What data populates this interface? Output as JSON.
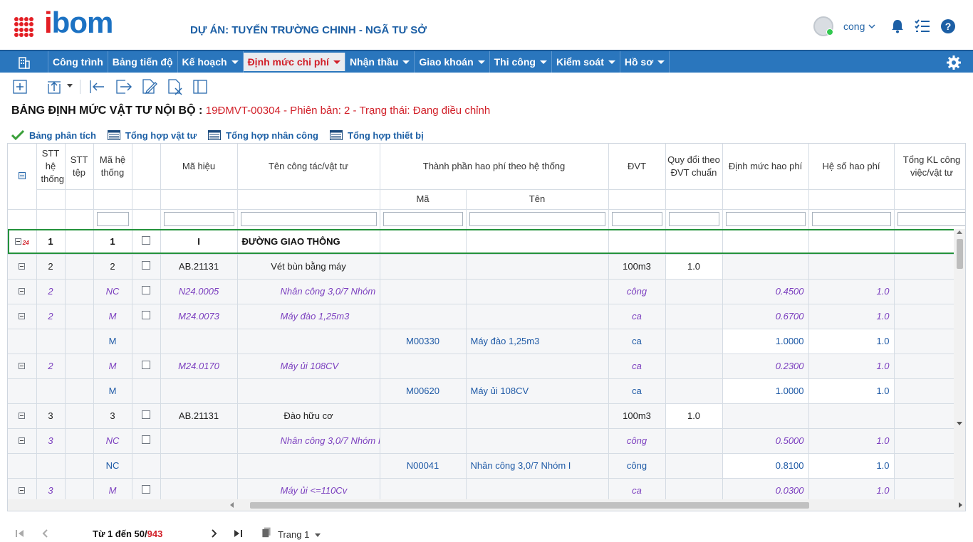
{
  "header": {
    "logo": {
      "part1": "i",
      "part2": "bom"
    },
    "project_title": "DỰ ÁN: TUYẾN TRƯỜNG CHINH - NGÃ TƯ SỞ",
    "username": "cong"
  },
  "nav": {
    "items": [
      {
        "label": "Công trình",
        "dropdown": false
      },
      {
        "label": "Bảng tiến độ",
        "dropdown": false
      },
      {
        "label": "Kế hoạch",
        "dropdown": true
      },
      {
        "label": "Định mức chi phí",
        "dropdown": true,
        "active": true
      },
      {
        "label": "Nhận thầu",
        "dropdown": true
      },
      {
        "label": "Giao khoán",
        "dropdown": true
      },
      {
        "label": "Thi công",
        "dropdown": true
      },
      {
        "label": "Kiểm soát",
        "dropdown": true
      },
      {
        "label": "Hồ sơ",
        "dropdown": true
      }
    ]
  },
  "doc": {
    "title": "BẢNG ĐỊNH MỨC VẬT TƯ NỘI BỘ :",
    "subtitle": "19ĐMVT-00304 - Phiên bản: 2 - Trạng thái: Đang điều chỉnh"
  },
  "tabs": [
    {
      "label": "Bảng phân tích",
      "icon": "check-icon"
    },
    {
      "label": "Tổng hợp vật tư",
      "icon": "table-icon"
    },
    {
      "label": "Tổng hợp nhân công",
      "icon": "table-icon"
    },
    {
      "label": "Tổng hợp thiết bị",
      "icon": "table-icon"
    }
  ],
  "grid": {
    "headers": {
      "stt_he_thong": "STT hệ thống",
      "stt_tep": "STT tệp",
      "ma_he_thong": "Mã hệ thống",
      "ma_hieu": "Mã hiệu",
      "ten_cong_tac": "Tên công tác/vật tư",
      "thanh_phan": "Thành phần hao phí theo hệ thống",
      "ma": "Mã",
      "ten": "Tên",
      "dvt": "ĐVT",
      "quy_doi": "Quy đổi theo ĐVT chuẩn",
      "dinh_muc": "Định mức hao phí",
      "he_so": "Hệ số hao phí",
      "tong_kl": "Tổng KL công việc/vật tư"
    },
    "rows": [
      {
        "type": "group",
        "expander": true,
        "count": "24",
        "stt": "1",
        "stt_tep": "",
        "ma_ht": "1",
        "checkbox": true,
        "ma_hieu": "I",
        "ten": "ĐƯỜNG GIAO THÔNG",
        "tp_ma": "",
        "tp_ten": "",
        "dvt": "",
        "quy_doi": "",
        "dinh_muc": "",
        "he_so": ""
      },
      {
        "type": "plain",
        "expander": true,
        "stt": "2",
        "stt_tep": "",
        "ma_ht": "2",
        "checkbox": true,
        "ma_hieu": "AB.21131",
        "ten": "Vét bùn bằng máy",
        "tp_ma": "",
        "tp_ten": "",
        "dvt": "100m3",
        "quy_doi": "1.0",
        "dinh_muc": "",
        "he_so": ""
      },
      {
        "type": "ital",
        "expander": true,
        "stt": "2",
        "stt_tep": "",
        "ma_ht": "NC",
        "checkbox": true,
        "ma_hieu": "N24.0005",
        "ten": "Nhân công 3,0/7 Nhóm",
        "tp_ma": "",
        "tp_ten": "",
        "dvt": "công",
        "quy_doi": "",
        "dinh_muc": "0.4500",
        "he_so": "1.0"
      },
      {
        "type": "ital",
        "expander": true,
        "stt": "2",
        "stt_tep": "",
        "ma_ht": "M",
        "checkbox": true,
        "ma_hieu": "M24.0073",
        "ten": "Máy đào 1,25m3",
        "tp_ma": "",
        "tp_ten": "",
        "dvt": "ca",
        "quy_doi": "",
        "dinh_muc": "0.6700",
        "he_so": "1.0"
      },
      {
        "type": "det",
        "expander": false,
        "stt": "",
        "stt_tep": "",
        "ma_ht": "M",
        "checkbox": false,
        "ma_hieu": "",
        "ten": "",
        "tp_ma": "M00330",
        "tp_ten": "Máy đào 1,25m3",
        "dvt": "ca",
        "quy_doi": "",
        "dinh_muc": "1.0000",
        "he_so": "1.0"
      },
      {
        "type": "ital",
        "expander": true,
        "stt": "2",
        "stt_tep": "",
        "ma_ht": "M",
        "checkbox": true,
        "ma_hieu": "M24.0170",
        "ten": "Máy ủi 108CV",
        "tp_ma": "",
        "tp_ten": "",
        "dvt": "ca",
        "quy_doi": "",
        "dinh_muc": "0.2300",
        "he_so": "1.0"
      },
      {
        "type": "det",
        "expander": false,
        "stt": "",
        "stt_tep": "",
        "ma_ht": "M",
        "checkbox": false,
        "ma_hieu": "",
        "ten": "",
        "tp_ma": "M00620",
        "tp_ten": "Máy ủi 108CV",
        "dvt": "ca",
        "quy_doi": "",
        "dinh_muc": "1.0000",
        "he_so": "1.0"
      },
      {
        "type": "plain",
        "expander": true,
        "stt": "3",
        "stt_tep": "",
        "ma_ht": "3",
        "checkbox": true,
        "ma_hieu": "AB.21131",
        "ten": "Đào hữu cơ",
        "tp_ma": "",
        "tp_ten": "",
        "dvt": "100m3",
        "quy_doi": "1.0",
        "dinh_muc": "",
        "he_so": ""
      },
      {
        "type": "ital",
        "expander": true,
        "stt": "3",
        "stt_tep": "",
        "ma_ht": "NC",
        "checkbox": true,
        "ma_hieu": "",
        "ten": "Nhân công 3,0/7 Nhóm I",
        "tp_ma": "",
        "tp_ten": "",
        "dvt": "công",
        "quy_doi": "",
        "dinh_muc": "0.5000",
        "he_so": "1.0"
      },
      {
        "type": "det",
        "expander": false,
        "stt": "",
        "stt_tep": "",
        "ma_ht": "NC",
        "checkbox": false,
        "ma_hieu": "",
        "ten": "",
        "tp_ma": "N00041",
        "tp_ten": "Nhân công 3,0/7 Nhóm I",
        "dvt": "công",
        "quy_doi": "",
        "dinh_muc": "0.8100",
        "he_so": "1.0"
      },
      {
        "type": "ital",
        "expander": true,
        "stt": "3",
        "stt_tep": "",
        "ma_ht": "M",
        "checkbox": true,
        "ma_hieu": "",
        "ten": "Máy ủi <=110Cv",
        "tp_ma": "",
        "tp_ten": "",
        "dvt": "ca",
        "quy_doi": "",
        "dinh_muc": "0.0300",
        "he_so": "1.0"
      }
    ]
  },
  "pager": {
    "range_text": "Từ 1 đến 50/",
    "total": "943",
    "page_label": "Trang 1"
  }
}
